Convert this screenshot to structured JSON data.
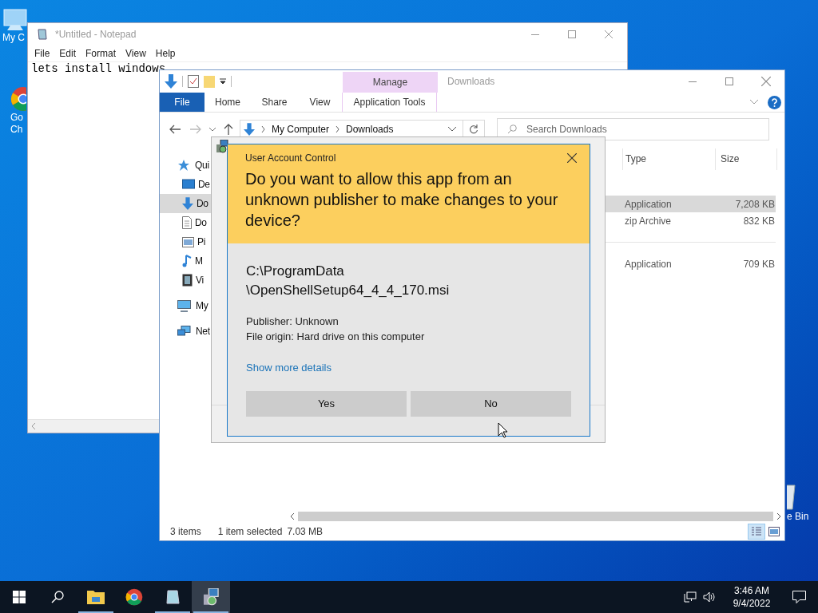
{
  "desktop": {
    "icons": [
      {
        "kind": "computer",
        "lines": [
          "My C"
        ]
      },
      {
        "kind": "chrome",
        "lines": [
          "Go",
          "Ch"
        ]
      },
      {
        "kind": "recycle",
        "lines": [
          "e Bin"
        ]
      }
    ]
  },
  "notepad": {
    "title": "*Untitled - Notepad",
    "menu": [
      "File",
      "Edit",
      "Format",
      "View",
      "Help"
    ],
    "text": "lets install windows"
  },
  "explorer": {
    "title": "Downloads",
    "context_tab": "Manage",
    "ribbon_tabs": [
      {
        "label": "File",
        "kind": "file",
        "selected": false
      },
      {
        "label": "Home",
        "kind": "tab",
        "selected": false
      },
      {
        "label": "Share",
        "kind": "tab",
        "selected": false
      },
      {
        "label": "View",
        "kind": "tab",
        "selected": false
      },
      {
        "label": "Application Tools",
        "kind": "context",
        "selected": false
      }
    ],
    "address": [
      "My Computer",
      "Downloads"
    ],
    "search": {
      "placeholder": "Search Downloads"
    },
    "nav_items": [
      {
        "label": "Qui",
        "kind": "star",
        "selected": false,
        "children": [
          {
            "label": "De",
            "kind": "desktop",
            "selected": false
          },
          {
            "label": "Do",
            "kind": "download",
            "selected": true
          },
          {
            "label": "Do",
            "kind": "document",
            "selected": false
          },
          {
            "label": "Pi",
            "kind": "pictures",
            "selected": false
          },
          {
            "label": "M",
            "kind": "music",
            "selected": false
          },
          {
            "label": "Vi",
            "kind": "video",
            "selected": false
          }
        ]
      },
      {
        "label": "My",
        "kind": "computer",
        "selected": false
      },
      {
        "label": "Net",
        "kind": "network",
        "selected": false
      }
    ],
    "columns": [
      "Type",
      "Size"
    ],
    "groups": [
      [
        {
          "type": "Application",
          "size": "7,208 KB",
          "selected": true
        },
        {
          "type": "zip Archive",
          "size": "832 KB",
          "selected": false
        }
      ],
      [
        {
          "type": "Application",
          "size": "709 KB",
          "selected": false
        }
      ]
    ],
    "status": {
      "count": "3 items",
      "selection": "1 item selected",
      "size": "7.03 MB"
    }
  },
  "uac": {
    "title": "User Account Control",
    "question": "Do you want to allow this app from an unknown publisher to make changes to your device?",
    "path_lines": [
      "C:\\ProgramData",
      "\\OpenShellSetup64_4_4_170.msi"
    ],
    "details": [
      "Publisher: Unknown",
      "File origin: Hard drive on this computer"
    ],
    "link": "Show more details",
    "buttons": [
      "Yes",
      "No"
    ]
  },
  "taskbar": {
    "apps": [
      {
        "kind": "folder",
        "running": true,
        "active": false
      },
      {
        "kind": "chrome",
        "running": false,
        "active": false
      },
      {
        "kind": "notepad",
        "running": true,
        "active": false
      },
      {
        "kind": "installer",
        "running": true,
        "active": true
      }
    ],
    "time": "3:46 AM",
    "date": "9/4/2022"
  }
}
